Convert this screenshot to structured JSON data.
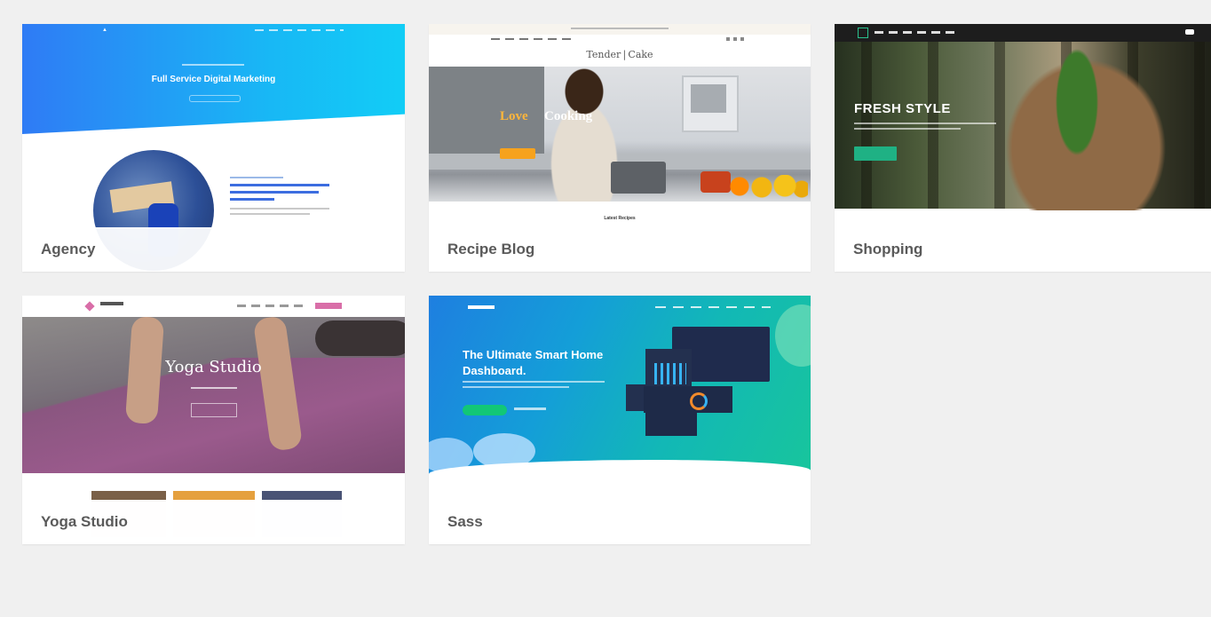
{
  "templates": [
    {
      "label": "Agency",
      "hero_title": "Full Service Digital Marketing"
    },
    {
      "label": "Recipe Blog",
      "logo": "Tender | Cake",
      "hero_title_accent": "Love",
      "hero_title": "Cooking",
      "section_title": "Latest Recipes"
    },
    {
      "label": "Shopping",
      "hero_title": "FRESH STYLE"
    },
    {
      "label": "Yoga Studio",
      "hero_title": "Yoga Studio"
    },
    {
      "label": "Sass",
      "hero_title": "The Ultimate Smart Home Dashboard."
    }
  ],
  "colors": {
    "page_background": "#f0f0f0",
    "card_background": "#ffffff",
    "label_text": "#5a5a5a",
    "agency_gradient_start": "#2f7bf5",
    "agency_gradient_end": "#12cdf6",
    "shopping_accent": "#1fb184",
    "yoga_accent": "#d96ea8",
    "sass_gradient_start": "#1e7fe0",
    "sass_gradient_end": "#18c59c"
  }
}
